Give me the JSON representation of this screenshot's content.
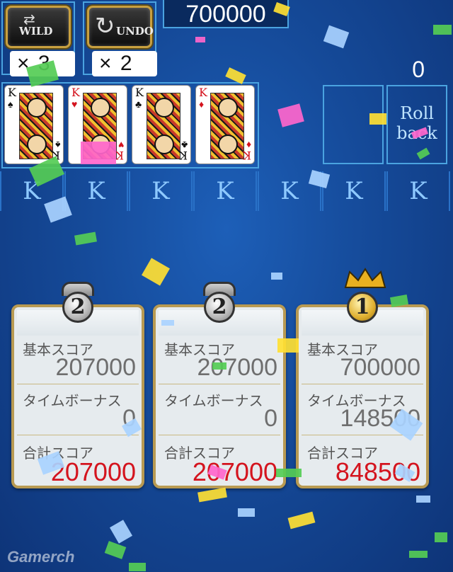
{
  "top": {
    "wild_label": "WILD",
    "undo_label": "UNDO",
    "wild_count": "× 3",
    "undo_count": "× 2",
    "score": "700000",
    "counter": "0"
  },
  "cards": [
    {
      "rank": "K",
      "suit": "♠",
      "color": "#111111"
    },
    {
      "rank": "K",
      "suit": "♥",
      "color": "#d4141e"
    },
    {
      "rank": "K",
      "suit": "♣",
      "color": "#111111"
    },
    {
      "rank": "K",
      "suit": "♦",
      "color": "#d4141e"
    }
  ],
  "rollback": {
    "line1": "Roll",
    "line2": "back"
  },
  "k_strip": [
    "K",
    "K",
    "K",
    "K",
    "K",
    "K",
    "K"
  ],
  "panels": [
    {
      "rank": "2",
      "base_label": "基本スコア",
      "base": "207000",
      "time_label": "タイムボーナス",
      "time": "0",
      "total_label": "合計スコア",
      "total": "207000"
    },
    {
      "rank": "2",
      "base_label": "基本スコア",
      "base": "207000",
      "time_label": "タイムボーナス",
      "time": "0",
      "total_label": "合計スコア",
      "total": "207000"
    },
    {
      "rank": "1",
      "base_label": "基本スコア",
      "base": "700000",
      "time_label": "タイムボーナス",
      "time": "148500",
      "total_label": "合計スコア",
      "total": "848500"
    }
  ],
  "watermark": "Gamerch",
  "colors": {
    "accent_frame": "#4aa3e0",
    "panel_border": "#b89a52",
    "total_red": "#d4141e"
  }
}
